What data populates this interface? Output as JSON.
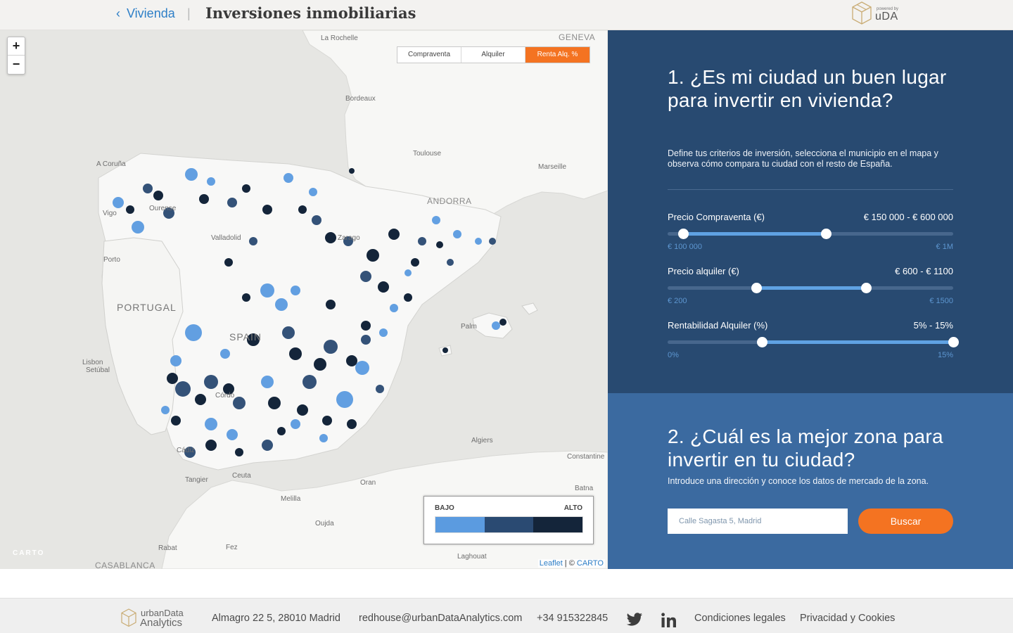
{
  "header": {
    "back_label": "Vivienda",
    "back_chevron": "‹",
    "separator": "|",
    "title": "Inversiones inmobiliarias",
    "powered_by": "powered by",
    "brand": "uDA"
  },
  "map": {
    "zoom_in": "+",
    "zoom_out": "−",
    "toggle": [
      "Compraventa",
      "Alquiler",
      "Renta Alq. %"
    ],
    "active_toggle": "Renta Alq. %",
    "labels": {
      "la_rochelle": "La Rochelle",
      "geneva": "GENEVA",
      "bordeaux": "Bordeaux",
      "toulouse": "Toulouse",
      "marseille": "Marseille",
      "a_coruna": "A Coruña",
      "vigo": "Vigo",
      "ourense": "Ourense",
      "andorra": "ANDORRA",
      "zaragoza": "Zarago",
      "valladolid": "Valladolid",
      "porto": "Porto",
      "portugal": "PORTUGAL",
      "spain": "SPAIN",
      "palma": "Palm",
      "lisbon": "Lisbon",
      "setubal": "Setúbal",
      "cordoba": "Córdo",
      "cadiz": "Cádiz",
      "ceuta": "Ceuta",
      "tangier": "Tangier",
      "algiers": "Algiers",
      "constantine": "Constantine",
      "oran": "Oran",
      "batna": "Batna",
      "melilla": "Melilla",
      "oujda": "Oujda",
      "rabat": "Rabat",
      "fez": "Fez",
      "casablanca": "CASABLANCA",
      "laghouat": "Laghouat"
    },
    "legend": {
      "low": "BAJO",
      "high": "ALTO",
      "colors": [
        "#5b9be0",
        "#2a4a72",
        "#14253a"
      ]
    },
    "attribution_leaflet": "Leaflet",
    "attribution_sep": " | © ",
    "attribution_carto": "CARTO",
    "carto_logo": "CARTO"
  },
  "panel1": {
    "heading": "1. ¿Es mi ciudad un buen lugar para invertir en vivienda?",
    "description": "Define tus criterios de inversión, selecciona el municipio en el mapa y observa cómo compara tu ciudad con el resto de España.",
    "sliders": [
      {
        "label": "Precio Compraventa (€)",
        "value": "€ 150 000 - € 600 000",
        "min": "€ 100 000",
        "max": "€ 1M",
        "low_pct": 5.5,
        "high_pct": 55.5
      },
      {
        "label": "Precio alquiler (€)",
        "value": "€ 600 - € 1100",
        "min": "€ 200",
        "max": "€ 1500",
        "low_pct": 31,
        "high_pct": 69.5
      },
      {
        "label": "Rentabilidad Alquiler (%)",
        "value": "5% - 15%",
        "min": "0%",
        "max": "15%",
        "low_pct": 33,
        "high_pct": 100
      }
    ]
  },
  "panel2": {
    "heading": "2. ¿Cuál es la mejor zona para invertir en tu ciudad?",
    "description": "Introduce una dirección y conoce los datos de mercado de la zona.",
    "search_placeholder": "Calle Sagasta 5, Madrid",
    "search_button": "Buscar"
  },
  "footer": {
    "brand_line1": "urbanData",
    "brand_line2": "Analytics",
    "address": "Almagro 22 5, 28010 Madrid",
    "email": "redhouse@urbanDataAnalytics.com",
    "phone": "+34 915322845",
    "twitter_icon": "twitter-icon",
    "linkedin_icon": "linkedin-icon",
    "legal": "Condiciones legales",
    "privacy": "Privacidad y Cookies"
  }
}
